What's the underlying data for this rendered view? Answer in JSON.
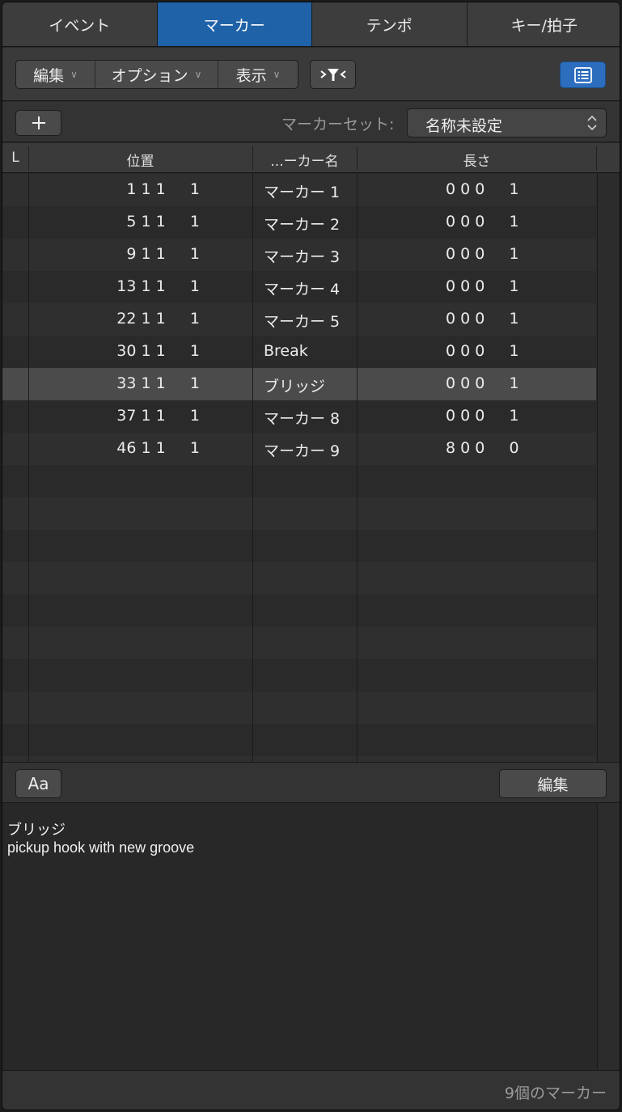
{
  "tabs": [
    {
      "label": "イベント",
      "active": false
    },
    {
      "label": "マーカー",
      "active": true
    },
    {
      "label": "テンポ",
      "active": false
    },
    {
      "label": "キー/拍子",
      "active": false
    }
  ],
  "toolbar": {
    "menus": [
      {
        "label": "編集",
        "icon": "chevron-down-icon"
      },
      {
        "label": "オプション",
        "icon": "chevron-down-icon"
      },
      {
        "label": "表示",
        "icon": "chevron-down-icon"
      }
    ],
    "filter_icon": "catch-filter-icon",
    "list_icon": "list-view-icon",
    "accent_color": "#2d6dbd"
  },
  "subbar": {
    "add_icon": "plus-icon",
    "marker_set_label": "マーカーセット:",
    "marker_set_value": "名称未設定"
  },
  "table": {
    "columns": [
      "L",
      "位置",
      "...ーカー名",
      "長さ"
    ],
    "rows": [
      {
        "position": "1 1 1     1",
        "name": "マーカー 1",
        "length": "0 0 0     1",
        "selected": false
      },
      {
        "position": "5 1 1     1",
        "name": "マーカー 2",
        "length": "0 0 0     1",
        "selected": false
      },
      {
        "position": "9 1 1     1",
        "name": "マーカー 3",
        "length": "0 0 0     1",
        "selected": false
      },
      {
        "position": "13 1 1     1",
        "name": "マーカー 4",
        "length": "0 0 0     1",
        "selected": false
      },
      {
        "position": "22 1 1     1",
        "name": "マーカー 5",
        "length": "0 0 0     1",
        "selected": false
      },
      {
        "position": "30 1 1     1",
        "name": "Break",
        "length": "0 0 0     1",
        "selected": false
      },
      {
        "position": "33 1 1     1",
        "name": "ブリッジ",
        "length": "0 0 0     1",
        "selected": true
      },
      {
        "position": "37 1 1     1",
        "name": "マーカー 8",
        "length": "0 0 0     1",
        "selected": false
      },
      {
        "position": "46 1 1     1",
        "name": "マーカー 9",
        "length": "8 0 0     0",
        "selected": false
      }
    ]
  },
  "bottombar": {
    "font_button": "Aa",
    "edit_button": "編集"
  },
  "notes": {
    "lines": [
      "ブリッジ",
      "pickup hook with new groove"
    ]
  },
  "status": {
    "count_text": "9個のマーカー"
  }
}
